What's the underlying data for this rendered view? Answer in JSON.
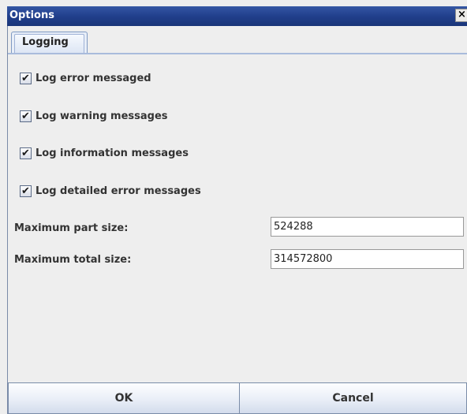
{
  "window": {
    "title": "Options",
    "close_glyph": "×"
  },
  "tabs": [
    {
      "label": "Logging",
      "selected": true
    }
  ],
  "checkboxes": [
    {
      "label": "Log error messaged",
      "checked": true,
      "glyph": "✔"
    },
    {
      "label": "Log warning messages",
      "checked": true,
      "glyph": "✔"
    },
    {
      "label": "Log information messages",
      "checked": true,
      "glyph": "✔"
    },
    {
      "label": "Log detailed error messages",
      "checked": true,
      "glyph": "✔"
    }
  ],
  "fields": [
    {
      "label": "Maximum part size:",
      "value": "524288"
    },
    {
      "label": "Maximum total size:",
      "value": "314572800"
    }
  ],
  "buttons": {
    "ok": "OK",
    "cancel": "Cancel"
  },
  "colors": {
    "title_bar": "#213f8c",
    "tab_border": "#7f9ac3",
    "window_bg": "#eeeeee"
  },
  "icons": {
    "close": "close-icon",
    "check": "checkmark-icon"
  }
}
